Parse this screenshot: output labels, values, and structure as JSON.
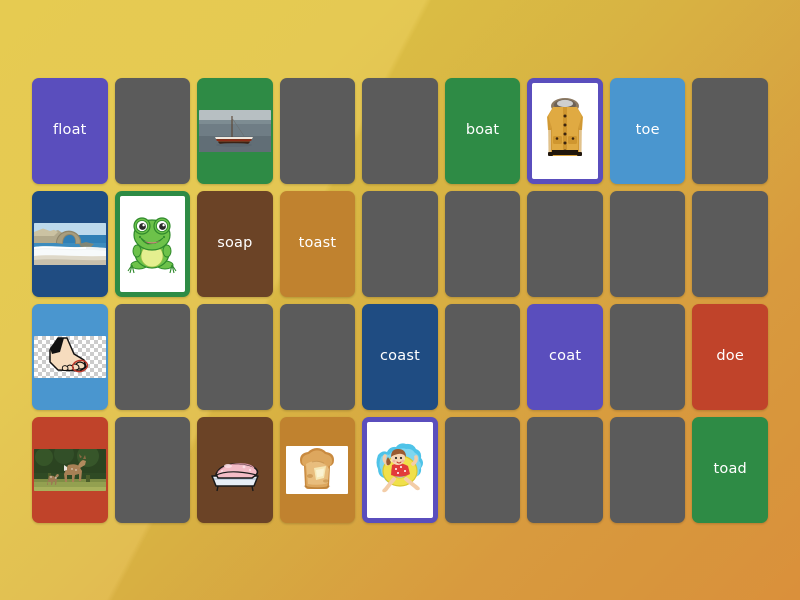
{
  "app": {
    "type": "matching-pairs-game-board",
    "background_color_start": "#e4c744",
    "background_color_end": "#e2953d",
    "columns": 9,
    "rows": 4
  },
  "palette": {
    "purple": "#5a4ebd",
    "grey": "#5b5b5b",
    "green": "#2e8b45",
    "blue_light": "#4a96cf",
    "blue_dark": "#1f4c82",
    "brown": "#6b4326",
    "ochre": "#c0822f",
    "red": "#c0432a",
    "white": "#ffffff"
  },
  "cards": [
    {
      "id": "r1c1",
      "row": 1,
      "col": 1,
      "kind": "text",
      "label": "float",
      "color": "purple"
    },
    {
      "id": "r1c2",
      "row": 1,
      "col": 2,
      "kind": "blank",
      "label": "",
      "color": "grey"
    },
    {
      "id": "r1c3",
      "row": 1,
      "col": 3,
      "kind": "image",
      "label": "",
      "color": "green",
      "image": "boat-photo"
    },
    {
      "id": "r1c4",
      "row": 1,
      "col": 4,
      "kind": "blank",
      "label": "",
      "color": "grey"
    },
    {
      "id": "r1c5",
      "row": 1,
      "col": 5,
      "kind": "blank",
      "label": "",
      "color": "grey"
    },
    {
      "id": "r1c6",
      "row": 1,
      "col": 6,
      "kind": "text",
      "label": "boat",
      "color": "green"
    },
    {
      "id": "r1c7",
      "row": 1,
      "col": 7,
      "kind": "framed",
      "label": "",
      "color": "purple",
      "image": "coat-illustration"
    },
    {
      "id": "r1c8",
      "row": 1,
      "col": 8,
      "kind": "text",
      "label": "toe",
      "color": "blue_light"
    },
    {
      "id": "r1c9",
      "row": 1,
      "col": 9,
      "kind": "blank",
      "label": "",
      "color": "grey"
    },
    {
      "id": "r2c1",
      "row": 2,
      "col": 1,
      "kind": "image",
      "label": "",
      "color": "blue_dark",
      "image": "coast-photo"
    },
    {
      "id": "r2c2",
      "row": 2,
      "col": 2,
      "kind": "framed",
      "label": "",
      "color": "green",
      "image": "frog-illustration"
    },
    {
      "id": "r2c3",
      "row": 2,
      "col": 3,
      "kind": "text",
      "label": "soap",
      "color": "brown"
    },
    {
      "id": "r2c4",
      "row": 2,
      "col": 4,
      "kind": "text",
      "label": "toast",
      "color": "ochre"
    },
    {
      "id": "r2c5",
      "row": 2,
      "col": 5,
      "kind": "blank",
      "label": "",
      "color": "grey"
    },
    {
      "id": "r2c6",
      "row": 2,
      "col": 6,
      "kind": "blank",
      "label": "",
      "color": "grey"
    },
    {
      "id": "r2c7",
      "row": 2,
      "col": 7,
      "kind": "blank",
      "label": "",
      "color": "grey"
    },
    {
      "id": "r2c8",
      "row": 2,
      "col": 8,
      "kind": "blank",
      "label": "",
      "color": "grey"
    },
    {
      "id": "r2c9",
      "row": 2,
      "col": 9,
      "kind": "blank",
      "label": "",
      "color": "grey"
    },
    {
      "id": "r3c1",
      "row": 3,
      "col": 1,
      "kind": "image",
      "label": "",
      "color": "blue_light",
      "image": "toe-illustration"
    },
    {
      "id": "r3c2",
      "row": 3,
      "col": 2,
      "kind": "blank",
      "label": "",
      "color": "grey"
    },
    {
      "id": "r3c3",
      "row": 3,
      "col": 3,
      "kind": "blank",
      "label": "",
      "color": "grey"
    },
    {
      "id": "r3c4",
      "row": 3,
      "col": 4,
      "kind": "blank",
      "label": "",
      "color": "grey"
    },
    {
      "id": "r3c5",
      "row": 3,
      "col": 5,
      "kind": "text",
      "label": "coast",
      "color": "blue_dark"
    },
    {
      "id": "r3c6",
      "row": 3,
      "col": 6,
      "kind": "blank",
      "label": "",
      "color": "grey"
    },
    {
      "id": "r3c7",
      "row": 3,
      "col": 7,
      "kind": "text",
      "label": "coat",
      "color": "purple"
    },
    {
      "id": "r3c8",
      "row": 3,
      "col": 8,
      "kind": "blank",
      "label": "",
      "color": "grey"
    },
    {
      "id": "r3c9",
      "row": 3,
      "col": 9,
      "kind": "text",
      "label": "doe",
      "color": "red"
    },
    {
      "id": "r4c1",
      "row": 4,
      "col": 1,
      "kind": "image",
      "label": "",
      "color": "red",
      "image": "doe-photo"
    },
    {
      "id": "r4c2",
      "row": 4,
      "col": 2,
      "kind": "blank",
      "label": "",
      "color": "grey"
    },
    {
      "id": "r4c3",
      "row": 4,
      "col": 3,
      "kind": "image",
      "label": "",
      "color": "brown",
      "image": "soap-illustration"
    },
    {
      "id": "r4c4",
      "row": 4,
      "col": 4,
      "kind": "image",
      "label": "",
      "color": "ochre",
      "image": "toast-photo"
    },
    {
      "id": "r4c5",
      "row": 4,
      "col": 5,
      "kind": "framed",
      "label": "",
      "color": "purple",
      "image": "float-illustration"
    },
    {
      "id": "r4c6",
      "row": 4,
      "col": 6,
      "kind": "blank",
      "label": "",
      "color": "grey"
    },
    {
      "id": "r4c7",
      "row": 4,
      "col": 7,
      "kind": "blank",
      "label": "",
      "color": "grey"
    },
    {
      "id": "r4c8",
      "row": 4,
      "col": 8,
      "kind": "blank",
      "label": "",
      "color": "grey"
    },
    {
      "id": "r4c9",
      "row": 4,
      "col": 9,
      "kind": "text",
      "label": "toad",
      "color": "green"
    }
  ]
}
